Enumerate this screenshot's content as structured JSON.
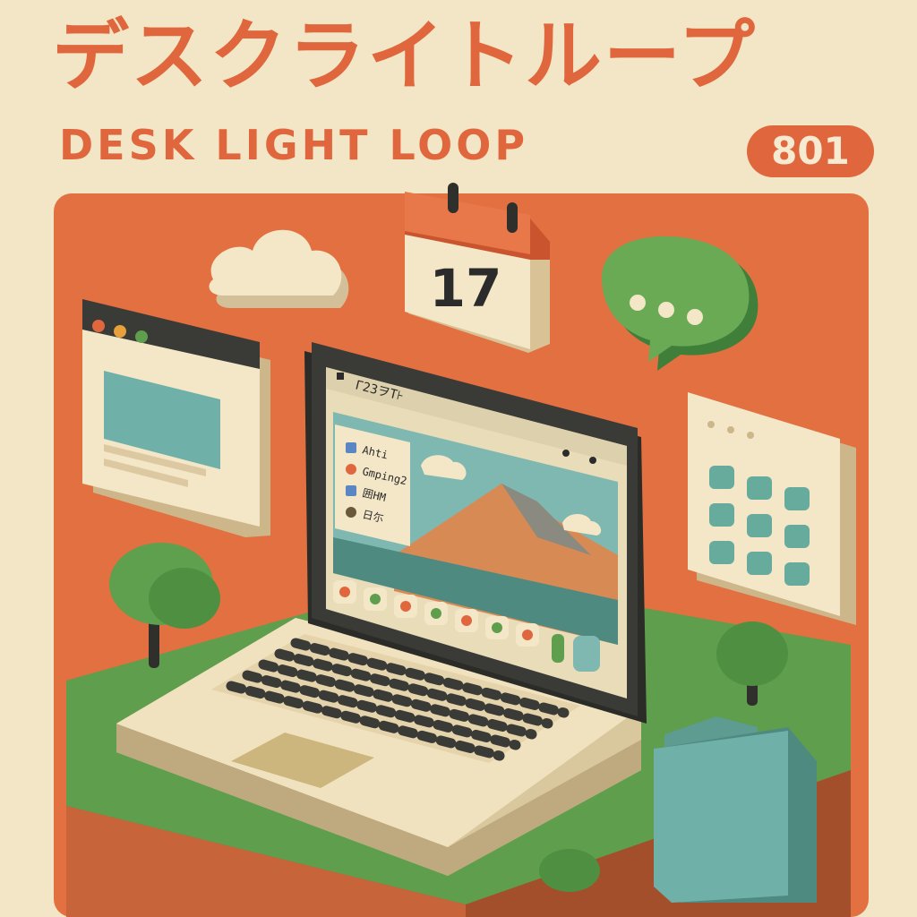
{
  "poster": {
    "title_jp": "デスクライトループ",
    "title_en": "DESK LIGHT LOOP",
    "issue_number": "801"
  },
  "calendar": {
    "day": "17"
  },
  "laptop": {
    "titlebar_text": "Γ23ヲΤ⊦",
    "notes": [
      "Ahti",
      "Gmping2",
      "囲HM",
      "日尓"
    ]
  },
  "icons": [
    "cloud-icon",
    "calendar-icon",
    "chat-bubble-icon",
    "browser-window-icon",
    "app-grid-icon",
    "laptop-icon",
    "mountain-landscape-icon",
    "folder-icon",
    "tree-icon"
  ],
  "colors": {
    "background": "#f3e6c6",
    "accent_orange": "#e0673d",
    "panel_orange": "#e27040",
    "grass_green": "#5e9e4c",
    "teal": "#67ab9c",
    "laptop_frame": "#3a3a36",
    "cream": "#f1e3c2"
  }
}
